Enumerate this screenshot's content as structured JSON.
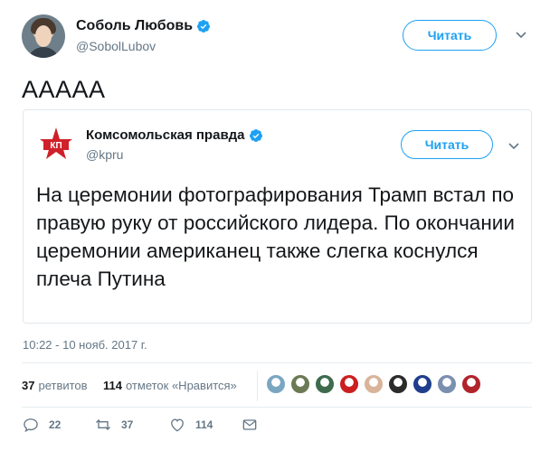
{
  "author": {
    "name": "Соболь Любовь",
    "handle": "@SobolLubov",
    "follow_label": "Читать"
  },
  "tweet": {
    "text": "ААААА"
  },
  "quoted": {
    "name": "Комсомольская правда",
    "handle": "@kpru",
    "follow_label": "Читать",
    "logo_text": "КП",
    "text": "На церемонии фотографирования Трамп встал по правую руку от российского лидера. По окончании церемонии американец также слегка коснулся плеча Путина"
  },
  "timestamp": "10:22 - 10 нояб. 2017 г.",
  "stats": {
    "retweets_count": "37",
    "retweets_label": "ретвитов",
    "likes_count": "114",
    "likes_label": "отметок «Нравится»"
  },
  "likers": [
    {
      "icon": "avatar",
      "color": "#7aa6c2"
    },
    {
      "icon": "avatar",
      "color": "#6b7a55"
    },
    {
      "icon": "avatar",
      "color": "#3e6b4d"
    },
    {
      "icon": "avatar",
      "color": "#cc1f1f"
    },
    {
      "icon": "avatar",
      "color": "#d8b49a"
    },
    {
      "icon": "avatar",
      "color": "#2b2b2b"
    },
    {
      "icon": "avatar",
      "color": "#1f3e8c"
    },
    {
      "icon": "avatar",
      "color": "#7b8fb0"
    },
    {
      "icon": "avatar",
      "color": "#b0242a"
    }
  ],
  "actions": {
    "replies": "22",
    "retweets": "37",
    "likes": "114"
  },
  "colors": {
    "accent": "#1da1f2",
    "text": "#14171a",
    "muted": "#657786",
    "border": "#e1e8ed",
    "kp_red": "#d0202a"
  }
}
